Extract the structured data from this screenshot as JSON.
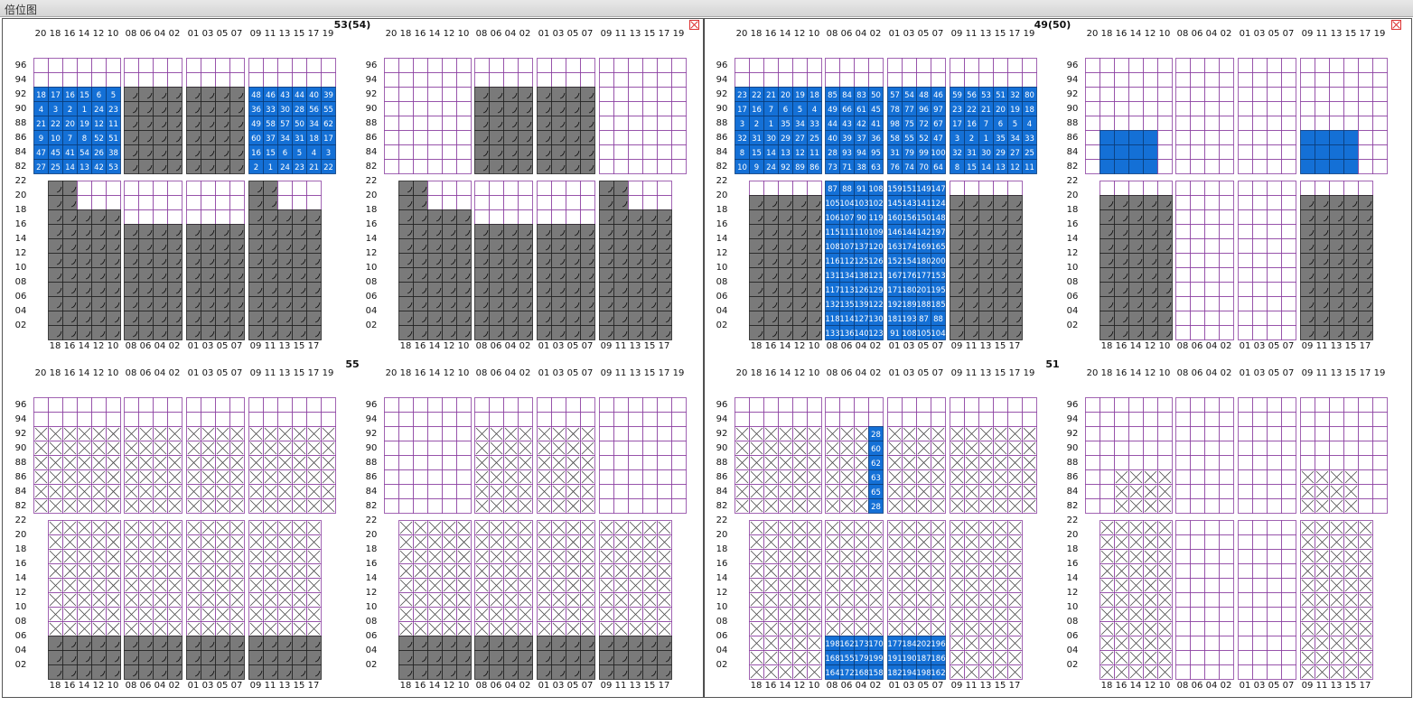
{
  "window": {
    "title": "倍位图"
  },
  "colors": {
    "grid": "#8a3ea0",
    "loaded": "#7a7a7a",
    "planned": "#1470d6",
    "empty": "#ffffff"
  },
  "icons": {
    "close": "close-icon"
  },
  "labels": {
    "row_top": [
      "20",
      "18",
      "16",
      "14",
      "12",
      "10",
      "08",
      "06",
      "04",
      "02",
      "01",
      "03",
      "05",
      "07",
      "09",
      "11",
      "13",
      "15",
      "17",
      "19"
    ],
    "row_bottom": [
      "18",
      "16",
      "14",
      "12",
      "10",
      "08",
      "06",
      "04",
      "02",
      "01",
      "03",
      "05",
      "07",
      "09",
      "11",
      "13",
      "15",
      "17"
    ],
    "tiers_deck": [
      "96",
      "94",
      "92",
      "90",
      "88",
      "86",
      "84",
      "82"
    ],
    "tiers_hold": [
      "22",
      "20",
      "18",
      "16",
      "14",
      "12",
      "10",
      "08",
      "06",
      "04",
      "02"
    ]
  },
  "bays": [
    {
      "title": "53(54)",
      "state": "loaded"
    },
    {
      "title": "49(50)",
      "state": "planned"
    },
    {
      "title": "55",
      "state": "blocked"
    },
    {
      "title": "51",
      "state": "partial"
    }
  ],
  "planned_numbers": {
    "bay53_deck": [
      "18",
      "17",
      "16",
      "15",
      "6",
      "5",
      "4",
      "3",
      "2",
      "1",
      "24",
      "23",
      "21",
      "22",
      "20",
      "19",
      "12",
      "11",
      "9",
      "10",
      "7",
      "8",
      "52",
      "51",
      "47",
      "45",
      "41",
      "54",
      "26",
      "38",
      "27",
      "25",
      "14",
      "13",
      "42",
      "53",
      "48",
      "46",
      "43",
      "44",
      "40",
      "39",
      "36",
      "33",
      "30",
      "28",
      "56",
      "55",
      "49",
      "58",
      "57",
      "50",
      "34",
      "62",
      "60",
      "37",
      "34",
      "31"
    ],
    "bay49_deck": [
      "23",
      "22",
      "21",
      "20",
      "19",
      "18",
      "17",
      "16",
      "7",
      "6",
      "5",
      "4",
      "3",
      "2",
      "1",
      "35",
      "34",
      "33",
      "32",
      "31",
      "30",
      "29",
      "27",
      "25",
      "8",
      "15",
      "14",
      "13",
      "12",
      "11",
      "10",
      "9",
      "24",
      "92",
      "89",
      "86",
      "85",
      "84",
      "83",
      "50",
      "49",
      "66",
      "61",
      "45",
      "44",
      "43",
      "42",
      "41",
      "40",
      "39",
      "37",
      "36",
      "28",
      "93",
      "94",
      "95",
      "73",
      "71",
      "38",
      "63",
      "57",
      "54",
      "48",
      "46",
      "78",
      "77",
      "96",
      "97",
      "98",
      "75",
      "72",
      "67",
      "58",
      "55",
      "52",
      "47",
      "31",
      "79",
      "99",
      "100",
      "76",
      "74",
      "70",
      "64",
      "59",
      "56",
      "53",
      "51",
      "32",
      "80"
    ],
    "bay49_hold": [
      "87",
      "88",
      "91",
      "108",
      "105",
      "104",
      "103",
      "102",
      "106",
      "107",
      "90",
      "119",
      "115",
      "111",
      "110",
      "109",
      "108",
      "107",
      "137",
      "120",
      "116",
      "112",
      "125",
      "126",
      "131",
      "134",
      "138",
      "121",
      "117",
      "113",
      "126",
      "129",
      "132",
      "135",
      "139",
      "122",
      "118",
      "114",
      "127",
      "130",
      "133",
      "136",
      "140",
      "123",
      "159",
      "151",
      "149",
      "147",
      "145",
      "143",
      "141",
      "124",
      "160",
      "156",
      "150",
      "148",
      "146",
      "144",
      "142",
      "197",
      "163",
      "174",
      "169",
      "165",
      "152",
      "154",
      "180",
      "200",
      "167",
      "176",
      "177",
      "153",
      "171",
      "180",
      "201",
      "195",
      "192",
      "189",
      "188",
      "185",
      "181",
      "193"
    ],
    "bay51_deck": [
      "28",
      "60",
      "62",
      "63",
      "65"
    ],
    "bay51_hold": [
      "198",
      "162",
      "173",
      "170",
      "168",
      "155",
      "179",
      "199",
      "164",
      "172",
      "168",
      "158",
      "177",
      "184",
      "202",
      "196",
      "191",
      "190",
      "187",
      "186",
      "182",
      "194"
    ]
  }
}
